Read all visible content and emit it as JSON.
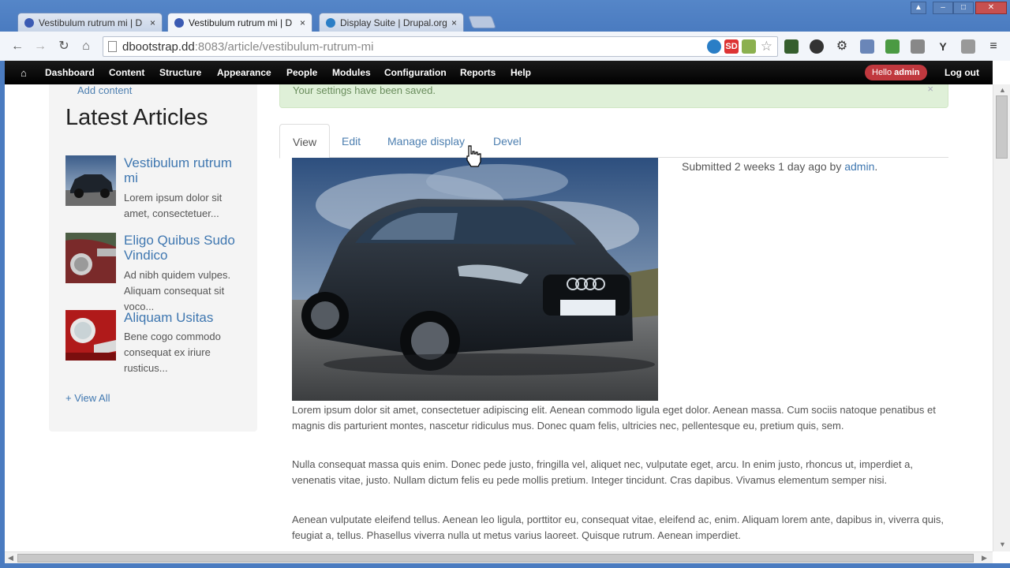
{
  "browser": {
    "tabs": [
      {
        "title": "Vestibulum rutrum mi | D",
        "close": "×"
      },
      {
        "title": "Vestibulum rutrum mi | D",
        "close": "×"
      },
      {
        "title": "Display Suite | Drupal.org",
        "close": "×"
      }
    ],
    "url_host": "dbootstrap.dd",
    "url_path": ":8083/article/vestibulum-rutrum-mi"
  },
  "admin_menu": {
    "items": [
      "Dashboard",
      "Content",
      "Structure",
      "Appearance",
      "People",
      "Modules",
      "Configuration",
      "Reports",
      "Help"
    ],
    "hello_prefix": "Hello ",
    "hello_user": "admin",
    "logout": "Log out"
  },
  "sidebar": {
    "add_content": "Add content",
    "title": "Latest Articles",
    "articles": [
      {
        "title": "Vestibulum rutrum mi",
        "summary": "Lorem ipsum dolor sit amet, consectetuer..."
      },
      {
        "title": "Eligo Quibus Sudo Vindico",
        "summary": "Ad nibh quidem vulpes. Aliquam consequat sit voco..."
      },
      {
        "title": "Aliquam Usitas",
        "summary": "Bene cogo commodo consequat ex iriure rusticus..."
      }
    ],
    "view_all": "+ View All"
  },
  "status_message": "Your settings have been saved.",
  "status_close": "×",
  "page_tabs": [
    "View",
    "Edit",
    "Manage display",
    "Devel"
  ],
  "submitted": {
    "prefix": "Submitted 2 weeks 1 day ago by ",
    "author": "admin",
    "suffix": "."
  },
  "body_paragraphs": [
    "Lorem ipsum dolor sit amet, consectetuer adipiscing elit. Aenean commodo ligula eget dolor. Aenean massa. Cum sociis natoque penatibus et magnis dis parturient montes, nascetur ridiculus mus. Donec quam felis, ultricies nec, pellentesque eu, pretium quis, sem.",
    "Nulla consequat massa quis enim. Donec pede justo, fringilla vel, aliquet nec, vulputate eget, arcu. In enim justo, rhoncus ut, imperdiet a, venenatis vitae, justo. Nullam dictum felis eu pede mollis pretium. Integer tincidunt. Cras dapibus. Vivamus elementum semper nisi.",
    "Aenean vulputate eleifend tellus. Aenean leo ligula, porttitor eu, consequat vitae, eleifend ac, enim. Aliquam lorem ante, dapibus in, viverra quis, feugiat a, tellus. Phasellus viverra nulla ut metus varius laoreet. Quisque rutrum. Aenean imperdiet."
  ],
  "colors": {
    "link": "#3f77b0",
    "hello_badge": "#c0383e",
    "status_bg": "#dff0d8"
  },
  "icons": [
    "drupal-icon",
    "back-arrow-icon",
    "forward-arrow-icon",
    "reload-icon",
    "home-icon",
    "page-icon",
    "star-icon",
    "menu-icon",
    "close-icon",
    "mouse-pointer-icon"
  ]
}
